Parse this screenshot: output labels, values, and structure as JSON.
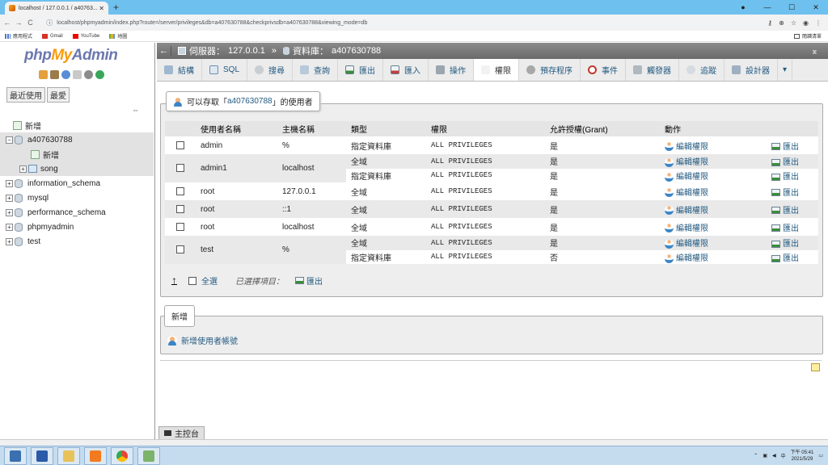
{
  "browser": {
    "tab_title": "localhost / 127.0.0.1 / a40763...",
    "url": "localhost/phpmyadmin/index.php?route=/server/privileges&db=a407630788&checkprivsdb=a407630788&viewing_mode=db",
    "bookmarks": [
      "應用程式",
      "Gmail",
      "YouTube",
      "地圖"
    ],
    "reading_list": "閱讀清單"
  },
  "sidebar": {
    "logo_php": "php",
    "logo_my": "My",
    "logo_admin": "Admin",
    "tabs": [
      "最近使用",
      "最愛"
    ],
    "tree": [
      {
        "label": "新增",
        "level": "top"
      },
      {
        "label": "a407630788",
        "level": "top"
      },
      {
        "label": "新增",
        "level": "child"
      },
      {
        "label": "song",
        "level": "child"
      },
      {
        "label": "information_schema",
        "level": "top"
      },
      {
        "label": "mysql",
        "level": "top"
      },
      {
        "label": "performance_schema",
        "level": "top"
      },
      {
        "label": "phpmyadmin",
        "level": "top"
      },
      {
        "label": "test",
        "level": "top"
      }
    ]
  },
  "topbar": {
    "server_label": "伺服器：",
    "server": "127.0.0.1",
    "sep": "»",
    "db_label": "資料庫：",
    "db": "a407630788"
  },
  "menu": [
    "結構",
    "SQL",
    "搜尋",
    "查詢",
    "匯出",
    "匯入",
    "操作",
    "權限",
    "預存程序",
    "事件",
    "觸發器",
    "追蹤",
    "設計器"
  ],
  "privileges": {
    "legend_pre": "可以存取「",
    "legend_db": "a407630788",
    "legend_post": "」的使用者",
    "headers": [
      "使用者名稱",
      "主機名稱",
      "類型",
      "權限",
      "允許授權(Grant)",
      "動作"
    ],
    "edit_label": "編輯權限",
    "export_label": "匯出",
    "users": [
      {
        "user": "admin",
        "host": "%",
        "rows": [
          {
            "type": "指定資料庫",
            "priv": "ALL PRIVILEGES",
            "grant": "是"
          }
        ]
      },
      {
        "user": "admin1",
        "host": "localhost",
        "rows": [
          {
            "type": "全域",
            "priv": "ALL PRIVILEGES",
            "grant": "是"
          },
          {
            "type": "指定資料庫",
            "priv": "ALL PRIVILEGES",
            "grant": "是"
          }
        ]
      },
      {
        "user": "root",
        "host": "127.0.0.1",
        "rows": [
          {
            "type": "全域",
            "priv": "ALL PRIVILEGES",
            "grant": "是"
          }
        ]
      },
      {
        "user": "root",
        "host": "::1",
        "rows": [
          {
            "type": "全域",
            "priv": "ALL PRIVILEGES",
            "grant": "是"
          }
        ]
      },
      {
        "user": "root",
        "host": "localhost",
        "rows": [
          {
            "type": "全域",
            "priv": "ALL PRIVILEGES",
            "grant": "是"
          }
        ]
      },
      {
        "user": "test",
        "host": "%",
        "rows": [
          {
            "type": "全域",
            "priv": "ALL PRIVILEGES",
            "grant": "是"
          },
          {
            "type": "指定資料庫",
            "priv": "ALL PRIVILEGES",
            "grant": "否"
          }
        ]
      }
    ],
    "select_all": "全選",
    "with_selected": "已選擇項目：",
    "bulk_export": "匯出"
  },
  "new_section": {
    "legend": "新增",
    "add_user": "新增使用者帳號"
  },
  "console": "主控台",
  "taskbar": {
    "time": "下午 05:41",
    "date": "2021/5/29"
  }
}
